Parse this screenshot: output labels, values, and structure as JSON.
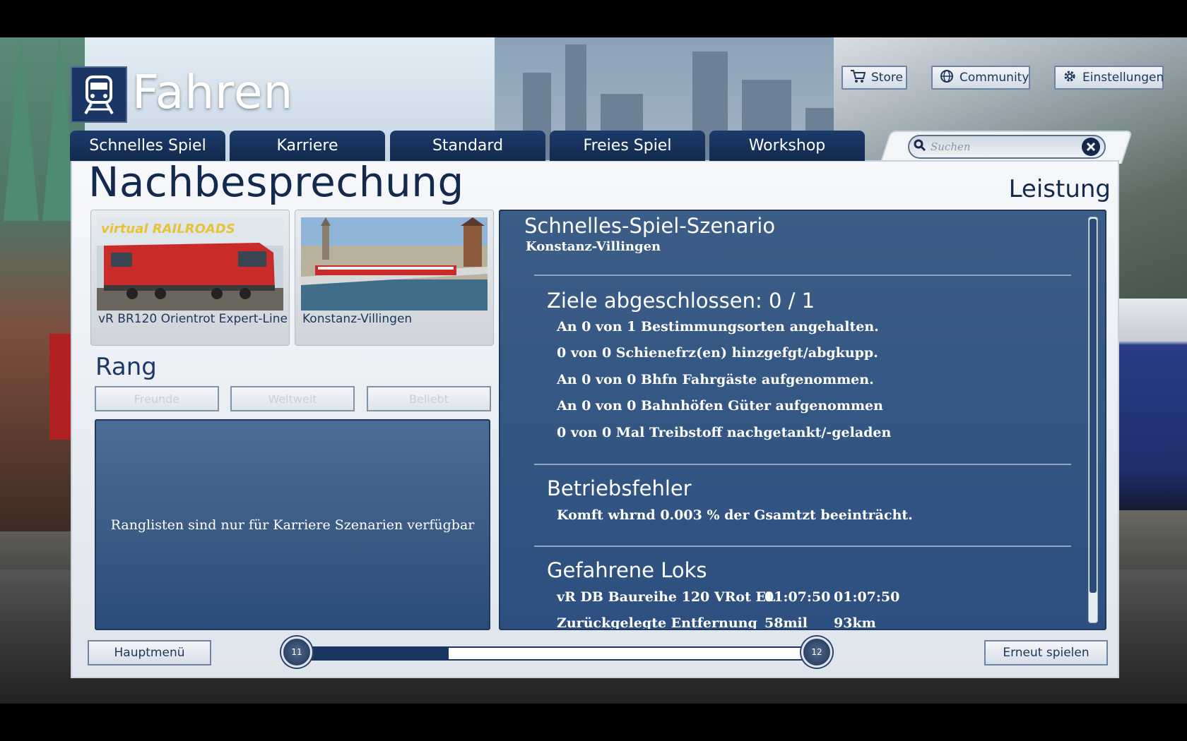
{
  "header": {
    "title": "Fahren",
    "buttons": {
      "store": "Store",
      "community": "Community",
      "settings": "Einstellungen"
    }
  },
  "nav": {
    "tabs": [
      "Schnelles Spiel",
      "Karriere",
      "Standard",
      "Freies Spiel",
      "Workshop"
    ]
  },
  "search": {
    "placeholder": "Suchen"
  },
  "page": {
    "heading": "Nachbesprechung",
    "right_heading": "Leistung"
  },
  "thumbs": [
    {
      "label": "vR BR120 Orientrot Expert-Line",
      "logo_text": "virtual RAILROADS"
    },
    {
      "label": "Konstanz-Villingen"
    }
  ],
  "rang": {
    "title": "Rang",
    "buttons": [
      "Freunde",
      "Weltweit",
      "Beliebt"
    ],
    "message": "Ranglisten sind nur für Karriere Szenarien verfügbar"
  },
  "results": {
    "title": "Schnelles-Spiel-Szenario",
    "subtitle": "Konstanz-Villingen",
    "goals": {
      "heading": "Ziele abgeschlossen: 0 / 1",
      "lines": [
        "An 0 von 1 Bestimmungsorten angehalten.",
        "0 von 0 Schienefrz(en) hinzgefgt/abgkupp.",
        "An 0 von 0 Bhfn Fahrgäste aufgenommen.",
        "An 0 von 0 Bahnhöfen Güter aufgenommen",
        "0 von 0 Mal Treibstoff nachgetankt/-geladen"
      ]
    },
    "errors": {
      "heading": "Betriebsfehler",
      "lines": [
        "Komft whrnd 0.003 % der Gsamtzt beeinträcht."
      ]
    },
    "locos": {
      "heading": "Gefahrene Loks",
      "rows": [
        {
          "name": "vR DB Baureihe 120 VRot EL",
          "c1": "01:07:50",
          "c2": "01:07:50"
        },
        {
          "name": "Zurückgelegte Entfernung",
          "c1": "58mil",
          "c2": "93km"
        }
      ]
    }
  },
  "bottom": {
    "main_menu": "Hauptmenü",
    "replay": "Erneut spielen",
    "level_current": "11",
    "level_next": "12",
    "progress": 0.3
  },
  "colors": {
    "navy": "#13294d",
    "panel_blue": "#2d5080",
    "accent": "#1b3561"
  }
}
